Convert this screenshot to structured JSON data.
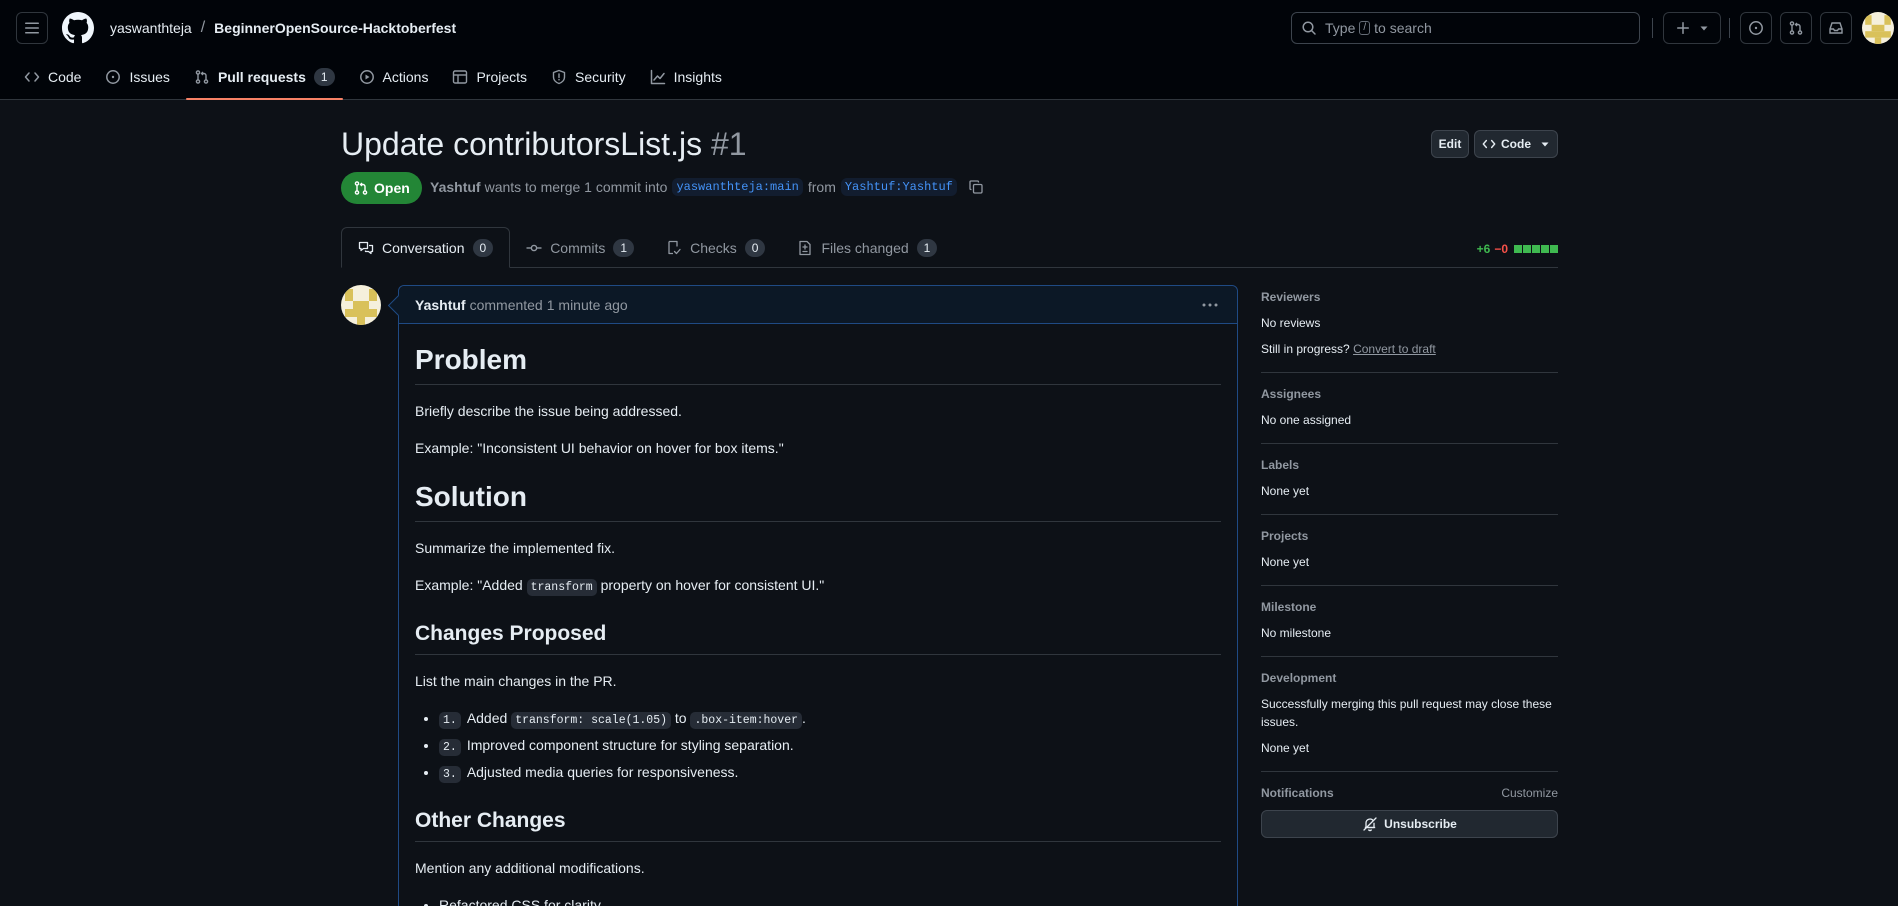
{
  "header": {
    "owner": "yaswanthteja",
    "separator": "/",
    "repo": "BeginnerOpenSource-Hacktoberfest",
    "search_pre": "Type",
    "search_key": "/",
    "search_post": "to search"
  },
  "repo_nav": {
    "code": "Code",
    "issues": "Issues",
    "pulls": "Pull requests",
    "pulls_count": "1",
    "actions": "Actions",
    "projects": "Projects",
    "security": "Security",
    "insights": "Insights"
  },
  "pr": {
    "title": "Update contributorsList.js",
    "number": "#1",
    "edit_label": "Edit",
    "code_label": "Code",
    "state": "Open",
    "author": "Yashtuf",
    "merge_text": "wants to merge 1 commit into",
    "base_branch": "yaswanthteja:main",
    "from_text": "from",
    "head_branch": "Yashtuf:Yashtuf"
  },
  "tabs": {
    "conversation": "Conversation",
    "conversation_count": "0",
    "commits": "Commits",
    "commits_count": "1",
    "checks": "Checks",
    "checks_count": "0",
    "files": "Files changed",
    "files_count": "1",
    "additions": "+6",
    "deletions": "−0"
  },
  "comment": {
    "author": "Yashtuf",
    "action": "commented",
    "time": "1 minute ago",
    "h_problem": "Problem",
    "p1": "Briefly describe the issue being addressed.",
    "p2": "Example: \"Inconsistent UI behavior on hover for box items.\"",
    "h_solution": "Solution",
    "p3": "Summarize the implemented fix.",
    "p4_pre": "Example: \"Added",
    "p4_code": "transform",
    "p4_post": "property on hover for consistent UI.\"",
    "h_changes": "Changes Proposed",
    "p5": "List the main changes in the PR.",
    "li1_num": "1.",
    "li1_pre": "Added",
    "li1_code1": "transform: scale(1.05)",
    "li1_mid": "to",
    "li1_code2": ".box-item:hover",
    "li1_post": ".",
    "li2_num": "2.",
    "li2_text": "Improved component structure for styling separation.",
    "li3_num": "3.",
    "li3_text": "Adjusted media queries for responsiveness.",
    "h_other": "Other Changes",
    "p6": "Mention any additional modifications.",
    "li4_text": "Refactored CSS for clarity."
  },
  "sidebar": {
    "reviewers_h": "Reviewers",
    "reviewers_v": "No reviews",
    "progress_q": "Still in progress?",
    "convert_link": "Convert to draft",
    "assignees_h": "Assignees",
    "assignees_v": "No one assigned",
    "labels_h": "Labels",
    "labels_v": "None yet",
    "projects_h": "Projects",
    "projects_v": "None yet",
    "milestone_h": "Milestone",
    "milestone_v": "No milestone",
    "development_h": "Development",
    "development_t": "Successfully merging this pull request may close these issues.",
    "development_v": "None yet",
    "notifications_h": "Notifications",
    "customize": "Customize",
    "unsubscribe": "Unsubscribe"
  },
  "colors": {
    "accent_open": "#238636",
    "link": "#4493f8",
    "tab_underline": "#f78166",
    "avatar": "#d9c15a"
  }
}
